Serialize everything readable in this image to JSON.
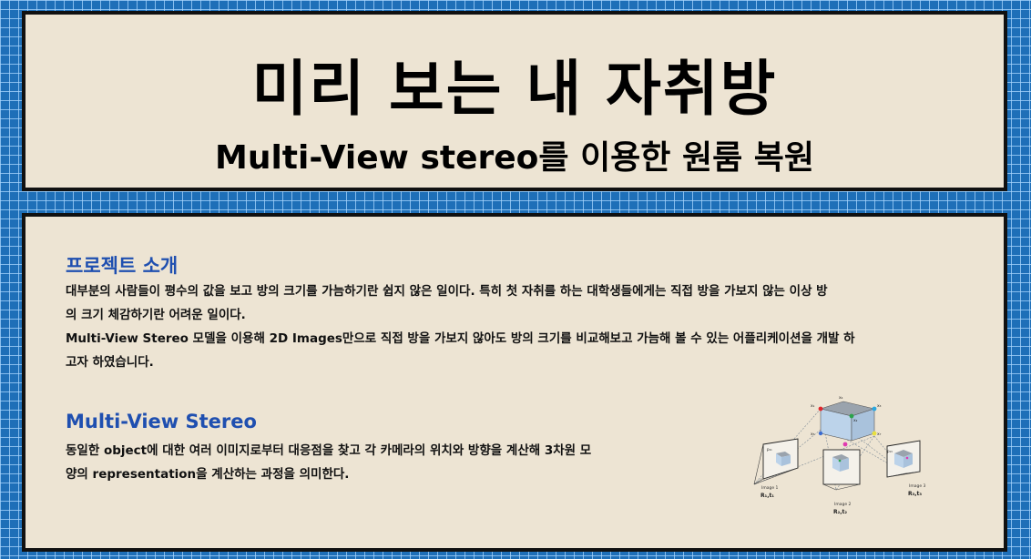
{
  "header": {
    "title": "미리 보는 내 자취방",
    "subtitle": "Multi-View stereo를 이용한 원룸 복원"
  },
  "project": {
    "heading": "프로젝트 소개",
    "lines": [
      "대부분의 사람들이 평수의 값을 보고 방의 크기를 가늠하기란 쉽지 않은 일이다. 특히  첫 자취를 하는 대학생들에게는 직접 방을 가보지 않는 이상 방",
      "의 크기 체감하기란 어려운 일이다.",
      "Multi-View Stereo 모델을 이용해 2D Images만으로 직접 방을 가보지 않아도 방의 크기를 비교해보고 가늠해 볼 수 있는 어플리케이션을 개발 하",
      "고자 하였습니다."
    ]
  },
  "mvs": {
    "heading": "Multi-View Stereo",
    "lines": [
      "동일한 object에 대한 여러 이미지로부터 대응점을 찾고 각 카메라의 위치와 방향을 계산해 3차원 모",
      "양의 representation을 계산하는  과정을 의미한다."
    ]
  },
  "figure": {
    "image1": "Image 1",
    "image2": "Image 2",
    "image3": "Image 3",
    "pose1": "R₁,t₁",
    "pose2": "R₂,t₂",
    "pose3": "R₃,t₃",
    "pts": [
      "x₁",
      "x₂",
      "x₃",
      "x₄",
      "x₅",
      "x₆",
      "x₇"
    ],
    "proj1": "p₁₁",
    "proj3": "p₁₃",
    "colors": {
      "cube_top": "#9aa3ad",
      "cube_front": "#bcd3ea",
      "cube_side": "#a9c2dc",
      "x1": "#e0262b",
      "x2": "#2ba34a",
      "x3": "#2aa8e0",
      "x6": "#e03ab0",
      "x7": "#e8e040"
    }
  }
}
